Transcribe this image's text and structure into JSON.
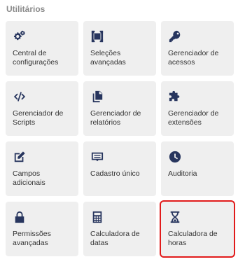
{
  "section": {
    "title": "Utilitários"
  },
  "colors": {
    "icon": "#27355e",
    "tile_bg": "#efefef",
    "highlight": "#e11b1b",
    "title": "#8a8a8a"
  },
  "tiles": [
    {
      "label": "Central de configurações",
      "icon": "cogs-icon",
      "highlighted": false
    },
    {
      "label": "Seleções avançadas",
      "icon": "selection-icon",
      "highlighted": false
    },
    {
      "label": "Gerenciador de acessos",
      "icon": "key-icon",
      "highlighted": false
    },
    {
      "label": "Gerenciador de Scripts",
      "icon": "code-icon",
      "highlighted": false
    },
    {
      "label": "Gerenciador de relatórios",
      "icon": "copy-icon",
      "highlighted": false
    },
    {
      "label": "Gerenciador de extensões",
      "icon": "puzzle-icon",
      "highlighted": false
    },
    {
      "label": "Campos adicionais",
      "icon": "edit-icon",
      "highlighted": false
    },
    {
      "label": "Cadastro único",
      "icon": "id-card-icon",
      "highlighted": false
    },
    {
      "label": "Auditoria",
      "icon": "clock-icon",
      "highlighted": false
    },
    {
      "label": "Permissões avançadas",
      "icon": "lock-icon",
      "highlighted": false
    },
    {
      "label": "Calculadora de datas",
      "icon": "calculator-icon",
      "highlighted": false
    },
    {
      "label": "Calculadora de horas",
      "icon": "hourglass-icon",
      "highlighted": true
    }
  ]
}
